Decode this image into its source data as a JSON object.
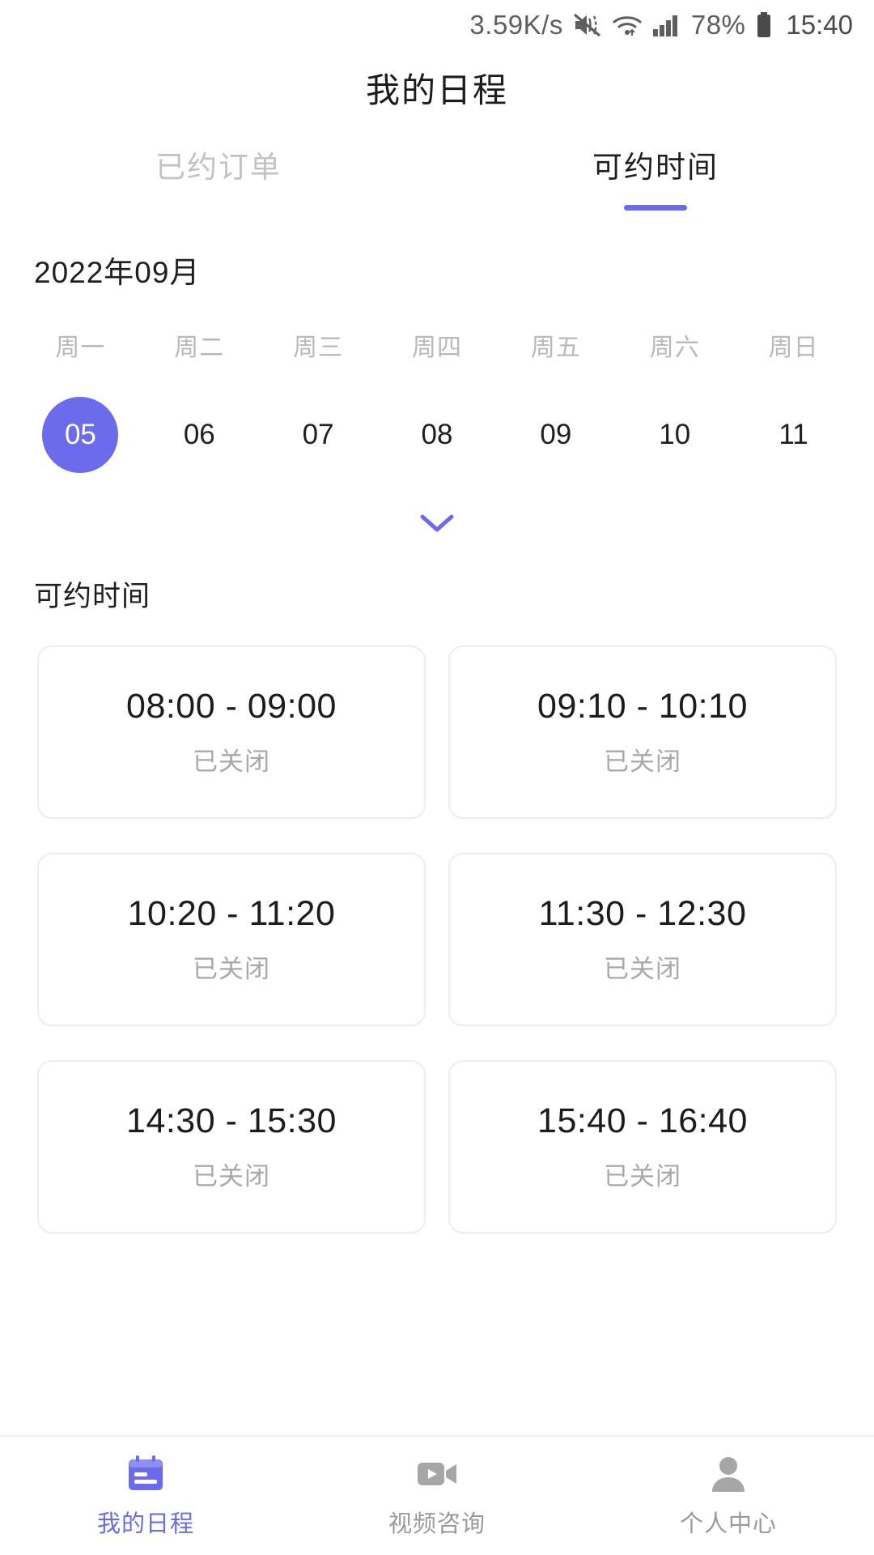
{
  "status_bar": {
    "network_speed": "3.59K/s",
    "mute_icon": "mute-icon",
    "wifi_icon": "wifi-icon",
    "signal_icon": "signal-bars-icon",
    "battery_percent": "78%",
    "battery_icon": "battery-icon",
    "time": "15:40"
  },
  "header": {
    "title": "我的日程"
  },
  "tabs": [
    {
      "label": "已约订单",
      "active": false
    },
    {
      "label": "可约时间",
      "active": true
    }
  ],
  "calendar": {
    "month_label": "2022年09月",
    "weekdays": [
      "周一",
      "周二",
      "周三",
      "周四",
      "周五",
      "周六",
      "周日"
    ],
    "days": [
      {
        "num": "05",
        "selected": true
      },
      {
        "num": "06",
        "selected": false
      },
      {
        "num": "07",
        "selected": false
      },
      {
        "num": "08",
        "selected": false
      },
      {
        "num": "09",
        "selected": false
      },
      {
        "num": "10",
        "selected": false
      },
      {
        "num": "11",
        "selected": false
      }
    ],
    "expand_icon": "chevron-down-icon"
  },
  "section": {
    "title": "可约时间"
  },
  "slots": [
    {
      "time": "08:00 - 09:00",
      "status": "已关闭"
    },
    {
      "time": "09:10 - 10:10",
      "status": "已关闭"
    },
    {
      "time": "10:20 - 11:20",
      "status": "已关闭"
    },
    {
      "time": "11:30 - 12:30",
      "status": "已关闭"
    },
    {
      "time": "14:30 - 15:30",
      "status": "已关闭"
    },
    {
      "time": "15:40 - 16:40",
      "status": "已关闭"
    }
  ],
  "bottom_nav": [
    {
      "label": "我的日程",
      "icon": "calendar-icon",
      "active": true
    },
    {
      "label": "视频咨询",
      "icon": "video-camera-icon",
      "active": false
    },
    {
      "label": "个人中心",
      "icon": "person-icon",
      "active": false
    }
  ],
  "colors": {
    "accent": "#6b6beb",
    "text_primary": "#1c1c1c",
    "text_muted": "#a9a9a9",
    "border": "#ededed"
  }
}
